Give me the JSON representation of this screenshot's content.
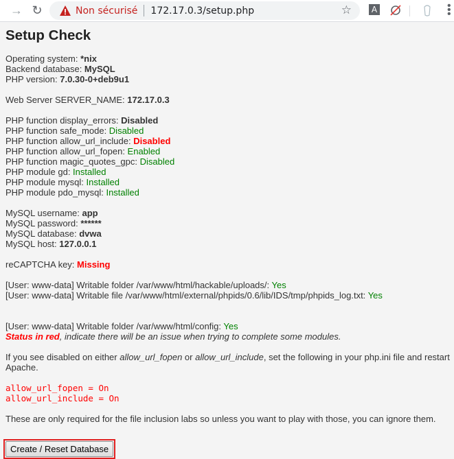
{
  "browser": {
    "security_label": "Non sécurisé",
    "url": "172.17.0.3/setup.php",
    "icons": [
      "forward-icon",
      "reload-icon",
      "warning-icon",
      "star-icon",
      "extension-a-icon",
      "extension-blocked-icon",
      "extension-profile-icon",
      "menu-icon"
    ],
    "extension_a_label": "A"
  },
  "page": {
    "title": "Setup Check",
    "system": [
      {
        "label": "Operating system: ",
        "value": "*nix"
      },
      {
        "label": "Backend database: ",
        "value": "MySQL"
      },
      {
        "label": "PHP version: ",
        "value": "7.0.30-0+deb9u1"
      }
    ],
    "server": {
      "label": "Web Server SERVER_NAME: ",
      "value": "172.17.0.3"
    },
    "php_checks": [
      {
        "label": "PHP function display_errors: ",
        "value": "Disabled",
        "status": "bold"
      },
      {
        "label": "PHP function safe_mode: ",
        "value": "Disabled",
        "status": "ok"
      },
      {
        "label": "PHP function allow_url_include: ",
        "value": "Disabled",
        "status": "error"
      },
      {
        "label": "PHP function allow_url_fopen: ",
        "value": "Enabled",
        "status": "ok"
      },
      {
        "label": "PHP function magic_quotes_gpc: ",
        "value": "Disabled",
        "status": "ok"
      },
      {
        "label": "PHP module gd: ",
        "value": "Installed",
        "status": "ok"
      },
      {
        "label": "PHP module mysql: ",
        "value": "Installed",
        "status": "ok"
      },
      {
        "label": "PHP module pdo_mysql: ",
        "value": "Installed",
        "status": "ok"
      }
    ],
    "mysql": [
      {
        "label": "MySQL username: ",
        "value": "app"
      },
      {
        "label": "MySQL password: ",
        "value": "******"
      },
      {
        "label": "MySQL database: ",
        "value": "dvwa"
      },
      {
        "label": "MySQL host: ",
        "value": "127.0.0.1"
      }
    ],
    "recaptcha": {
      "label": "reCAPTCHA key: ",
      "value": "Missing"
    },
    "writable": [
      {
        "label": "[User: www-data] Writable folder /var/www/html/hackable/uploads/: ",
        "value": "Yes"
      },
      {
        "label": "[User: www-data] Writable file /var/www/html/external/phpids/0.6/lib/IDS/tmp/phpids_log.txt: ",
        "value": "Yes"
      },
      {
        "label": "[User: www-data] Writable folder /var/www/html/config: ",
        "value": "Yes"
      }
    ],
    "status_note": {
      "red_part": "Status in red",
      "rest": ", indicate there will be an issue when trying to complete some modules."
    },
    "instructions": {
      "part1": "If you see disabled on either ",
      "em1": "allow_url_fopen",
      "part2": " or ",
      "em2": "allow_url_include",
      "part3": ", set the following in your php.ini file and restart Apache."
    },
    "code_lines": [
      "allow_url_fopen = On",
      "allow_url_include = On"
    ],
    "footer_note": "These are only required for the file inclusion labs so unless you want to play with those, you can ignore them.",
    "button_label": "Create / Reset Database"
  },
  "colors": {
    "ok": "#008000",
    "error": "#ff0000",
    "highlight": "#e02020"
  }
}
